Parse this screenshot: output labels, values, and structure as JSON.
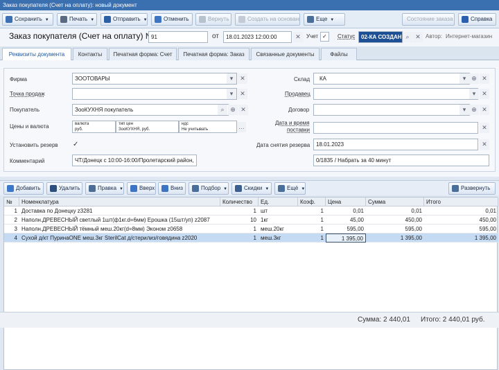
{
  "window": {
    "title": "Заказ покупателя (Счет на оплату): новый документ"
  },
  "toolbar": {
    "save": "Сохранить",
    "print": "Печать",
    "send": "Отправить",
    "undo": "Отменить",
    "redo": "Вернуть",
    "create_base": "Создать на основании",
    "more": "Еще",
    "order_state": "Состояние заказа",
    "help": "Справка"
  },
  "header": {
    "title": "Заказ покупателя (Счет на оплату) №",
    "number": "91",
    "from_label": "от",
    "date": "18.01.2023 12:00:00",
    "account_label": "Учет",
    "account_checked": "✓",
    "status_label": "Статус",
    "status_value": "02-КА СОЗДАН",
    "author_label": "Автор:",
    "author_value": "Интернет-магазин"
  },
  "tabs": [
    {
      "label": "Реквизиты документа"
    },
    {
      "label": "Контакты"
    },
    {
      "label": "Печатная форма: Счет"
    },
    {
      "label": "Печатная форма: Заказ"
    },
    {
      "label": "Связанные документы"
    },
    {
      "label": "Файлы"
    }
  ],
  "form": {
    "firm_label": "Фирма",
    "firm_value": "ЗООТОВАРЫ",
    "point_label": "Точка продаж",
    "point_value": "",
    "buyer_label": "Покупатель",
    "buyer_value": "ЗооКУХНЯ покупатель",
    "prices_label": "Цены и валюта",
    "currency_caption": "валюта",
    "currency_value": "руб.",
    "price_type_caption": "тип цен",
    "price_type_value": "ЗооКУХНЯ, руб.",
    "vat_caption": "ндс",
    "vat_value": "Не учитывать",
    "reserve_label": "Установить резерв",
    "reserve_check": "✓",
    "comment_label": "Комментарий",
    "comment_value": "ЧТ/Донецк с 10:00-16:00/Пролетарский район,",
    "comment_value_right": "0/1835 / Набрать за 40 минут",
    "warehouse_label": "Склад",
    "warehouse_value": "КА",
    "seller_label": "Продавец",
    "seller_value": "",
    "contract_label": "Договор",
    "contract_value": "",
    "delivery_label_1": "Дата и время",
    "delivery_label_2": "поставки",
    "delivery_value": "",
    "reserve_date_label": "Дата снятия резерва",
    "reserve_date_value": "18.01.2023"
  },
  "grid_toolbar": {
    "add": "Добавить",
    "delete": "Удалить",
    "edit": "Правка",
    "up": "Вверх",
    "down": "Вниз",
    "select": "Подбор",
    "discounts": "Скидки",
    "more": "Ещё",
    "expand": "Развернуть"
  },
  "grid": {
    "columns": [
      "№",
      "Номенклатура",
      "Количество",
      "Ед.",
      "Коэф.",
      "Цена",
      "Сумма",
      "Итого"
    ],
    "rows": [
      {
        "n": "1",
        "name": "Доставка по Донецку z3281",
        "qty": "1",
        "unit": "шт",
        "coef": "1",
        "price": "0,01",
        "sum": "0,01",
        "total": "0,01"
      },
      {
        "n": "2",
        "name": "Наполн.ДРЕВЕСНЫЙ светлый 1шт(ф1кг.d=6мм) Ерошка (15шт/уп) z2087",
        "qty": "10",
        "unit": "1кг",
        "coef": "1",
        "price": "45,00",
        "sum": "450,00",
        "total": "450,00"
      },
      {
        "n": "3",
        "name": "Наполн.ДРЕВЕСНЫЙ тёмный меш.20кг(d=8мм) Эконом z0658",
        "qty": "1",
        "unit": "меш.20кг",
        "coef": "1",
        "price": "595,00",
        "sum": "595,00",
        "total": "595,00"
      },
      {
        "n": "4",
        "name": "Сухой д/кт ПуринаONE меш.3кг SterilCat д/стерилиз/говядина z2020",
        "qty": "1",
        "unit": "меш.3кг",
        "coef": "1",
        "price": "1 395,00",
        "sum": "1 395,00",
        "total": "1 395,00"
      }
    ]
  },
  "footer": {
    "sum": "Сумма: 2 440,01",
    "total": "Итого: 2 440,01 руб."
  }
}
